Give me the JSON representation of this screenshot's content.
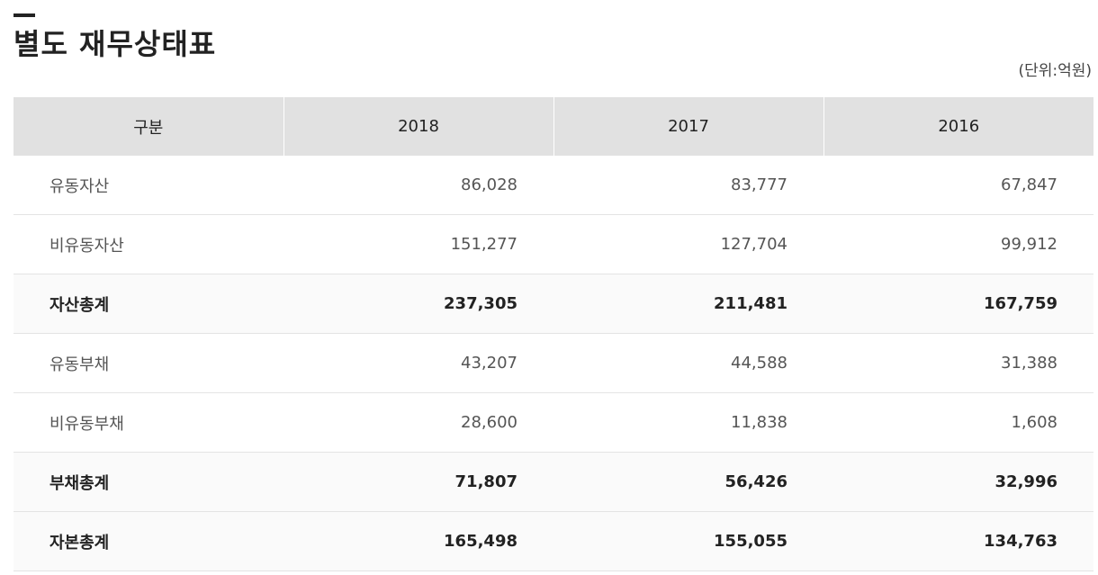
{
  "title": "별도 재무상태표",
  "unit": "(단위:억원)",
  "table": {
    "headers": [
      "구분",
      "2018",
      "2017",
      "2016"
    ],
    "rows": [
      {
        "label": "유동자산",
        "values": [
          "86,028",
          "83,777",
          "67,847"
        ],
        "total": false
      },
      {
        "label": "비유동자산",
        "values": [
          "151,277",
          "127,704",
          "99,912"
        ],
        "total": false
      },
      {
        "label": "자산총계",
        "values": [
          "237,305",
          "211,481",
          "167,759"
        ],
        "total": true
      },
      {
        "label": "유동부채",
        "values": [
          "43,207",
          "44,588",
          "31,388"
        ],
        "total": false
      },
      {
        "label": "비유동부채",
        "values": [
          "28,600",
          "11,838",
          "1,608"
        ],
        "total": false
      },
      {
        "label": "부채총계",
        "values": [
          "71,807",
          "56,426",
          "32,996"
        ],
        "total": true
      },
      {
        "label": "자본총계",
        "values": [
          "165,498",
          "155,055",
          "134,763"
        ],
        "total": true
      }
    ]
  }
}
